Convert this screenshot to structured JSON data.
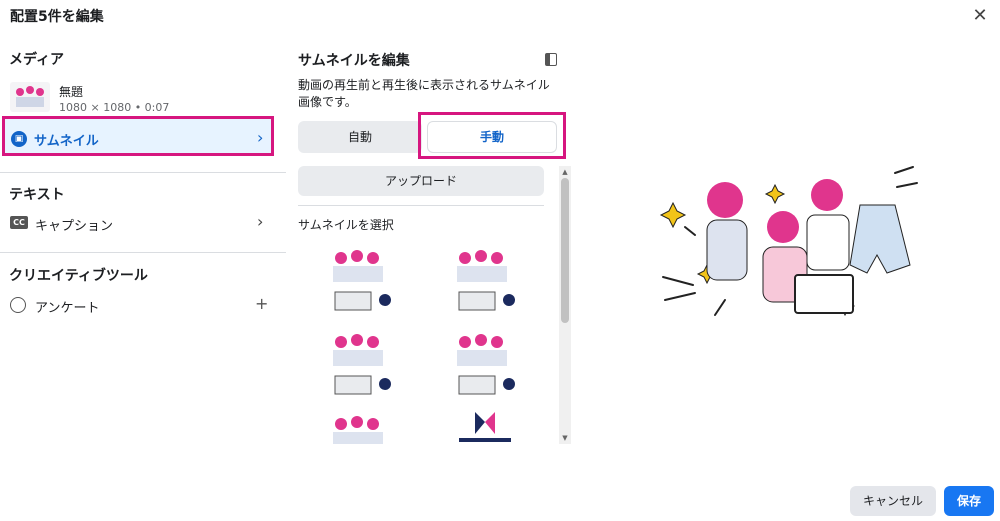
{
  "dialog": {
    "title": "配置5件を編集",
    "close_icon": "close-icon"
  },
  "left": {
    "media_heading": "メディア",
    "media_item": {
      "name": "無題",
      "meta": "1080 × 1080 • 0:07"
    },
    "thumbnail_row": {
      "label": "サムネイル",
      "icon": "image-icon"
    },
    "text_heading": "テキスト",
    "caption_row": {
      "label": "キャプション",
      "icon_text": "CC"
    },
    "tools_heading": "クリエイティブツール",
    "poll_row": {
      "label": "アンケート"
    }
  },
  "middle": {
    "heading": "サムネイルを編集",
    "description": "動画の再生前と再生後に表示されるサムネイル画像です。",
    "segment_auto": "自動",
    "segment_manual": "手動",
    "selected_segment": "手動",
    "upload_button": "アップロード",
    "select_heading": "サムネイルを選択",
    "thumbnails": [
      "thumb-illustration",
      "thumb-illustration",
      "thumb-illustration",
      "thumb-illustration",
      "thumb-illustration",
      "thumb-logo"
    ]
  },
  "footer": {
    "cancel": "キャンセル",
    "save": "保存"
  },
  "colors": {
    "highlight": "#d6167f",
    "accent": "#1264c8",
    "primary": "#1877f2",
    "selected_bg": "#e7f3ff"
  }
}
